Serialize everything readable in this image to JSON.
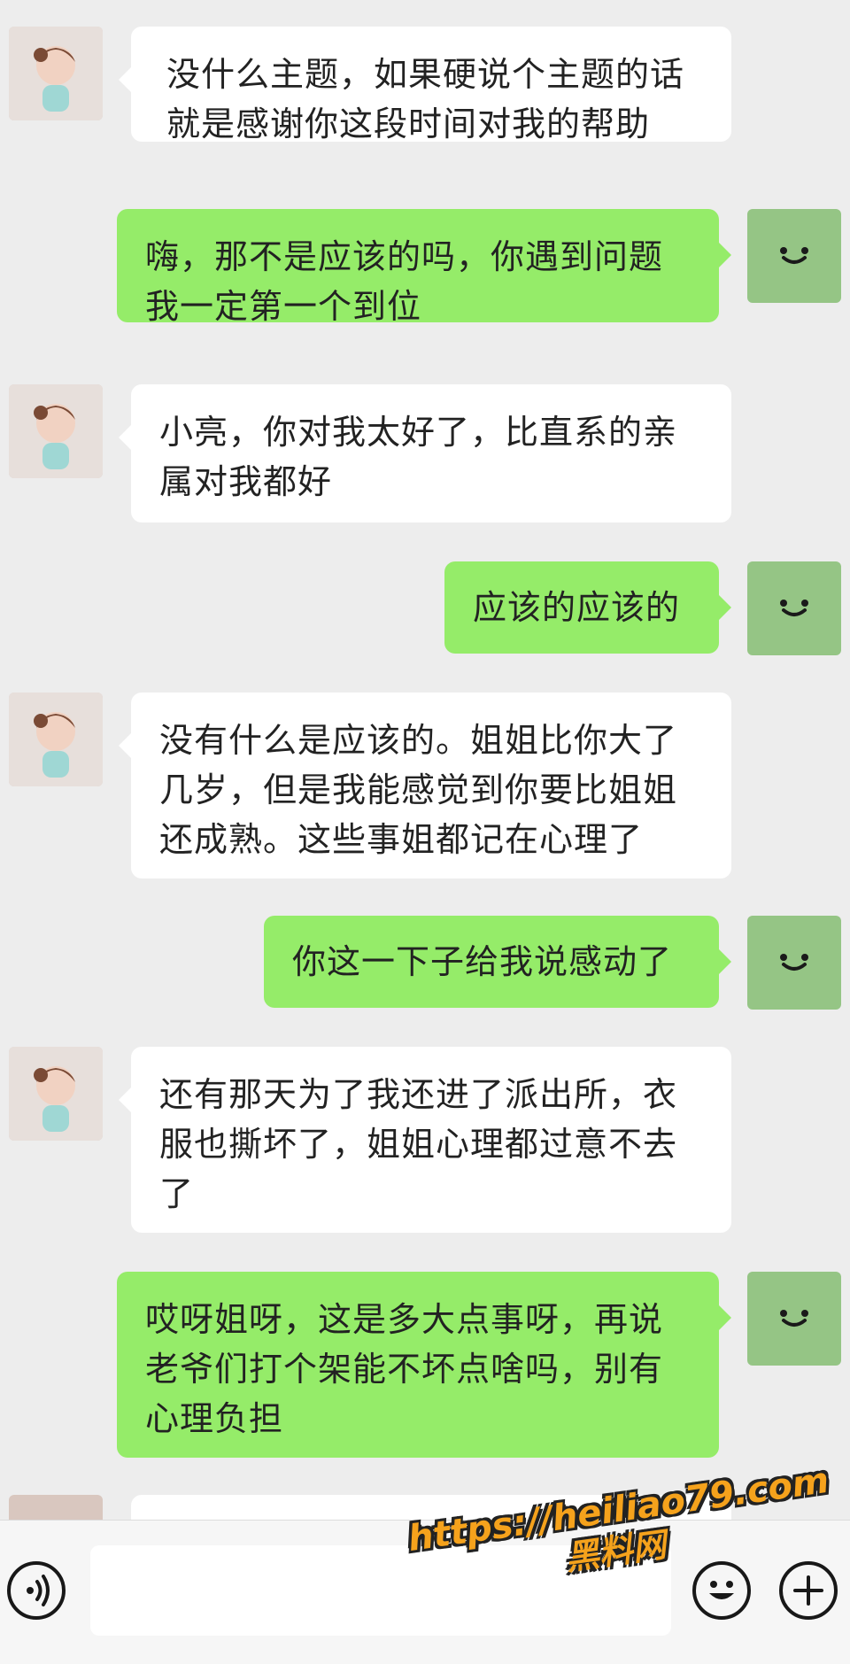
{
  "messages": [
    {
      "from": "other",
      "text": "没什么主题，如果硬说个主题的话就是感谢你这段时间对我的帮助"
    },
    {
      "from": "me",
      "text": "嗨，那不是应该的吗，你遇到问题我一定第一个到位"
    },
    {
      "from": "other",
      "text": "小亮，你对我太好了，比直系的亲属对我都好"
    },
    {
      "from": "me",
      "text": "应该的应该的"
    },
    {
      "from": "other",
      "text": "没有什么是应该的。姐姐比你大了几岁，但是我能感觉到你要比姐姐还成熟。这些事姐都记在心理了"
    },
    {
      "from": "me",
      "text": "你这一下子给我说感动了"
    },
    {
      "from": "other",
      "text": "还有那天为了我还进了派出所，衣服也撕坏了，姐姐心理都过意不去了"
    },
    {
      "from": "me",
      "text": "哎呀姐呀，这是多大点事呀，再说老爷们打个架能不坏点啥吗，别有心理负担"
    }
  ],
  "input": {
    "value": ""
  },
  "watermark": {
    "url": "https://heiliao79.com",
    "name": "黑料网"
  },
  "colors": {
    "background": "#ededed",
    "my_bubble": "#95ec69",
    "their_bubble": "#ffffff",
    "my_avatar": "#95c585",
    "watermark": "#f5a21c"
  },
  "icons": {
    "voice": "voice-icon",
    "emoji": "emoji-icon",
    "plus": "plus-icon",
    "my_avatar": "smiley-avatar-icon"
  }
}
